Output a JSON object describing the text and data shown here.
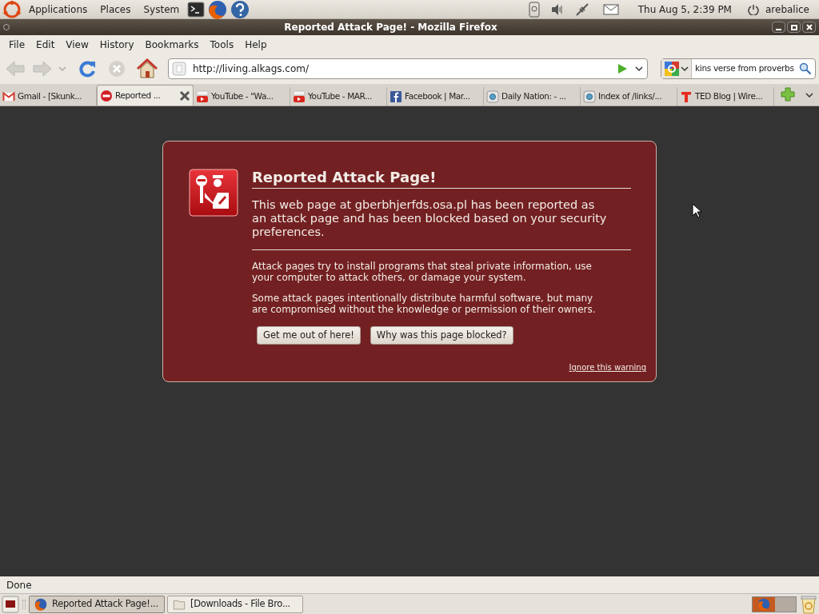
{
  "top_panel": {
    "menus": [
      "Applications",
      "Places",
      "System"
    ],
    "clock": "Thu Aug  5,  2:39 PM",
    "user": "arebalice"
  },
  "window": {
    "title": "Reported Attack Page! - Mozilla Firefox"
  },
  "menu_bar": [
    "File",
    "Edit",
    "View",
    "History",
    "Bookmarks",
    "Tools",
    "Help"
  ],
  "nav": {
    "url": "http://living.alkags.com/",
    "search_value": "kins verse from proverbs"
  },
  "tabs": [
    {
      "kind": "gmail",
      "label": "Gmail - [Skunk...",
      "selected": false
    },
    {
      "kind": "blocked",
      "label": "Reported ...",
      "selected": true
    },
    {
      "kind": "youtube",
      "label": "YouTube - \"Wa...",
      "selected": false
    },
    {
      "kind": "youtube",
      "label": "YouTube - MAR...",
      "selected": false
    },
    {
      "kind": "facebook",
      "label": "Facebook | Mar...",
      "selected": false
    },
    {
      "kind": "globe",
      "label": "Daily Nation: - ...",
      "selected": false
    },
    {
      "kind": "globe",
      "label": "Index of /links/...",
      "selected": false
    },
    {
      "kind": "ted",
      "label": "TED Blog | Wire...",
      "selected": false
    }
  ],
  "warning": {
    "title": "Reported Attack Page!",
    "lead": "This web page at gberbhjerfds.osa.pl has been reported as an attack page and has been blocked based on your security preferences.",
    "paragraphs": [
      "Attack pages try to install programs that steal private information, use your computer to attack others, or damage your system.",
      "Some attack pages intentionally distribute harmful software, but many are compromised without the knowledge or permission of their owners."
    ],
    "buttons": [
      "Get me out of here!",
      "Why was this page blocked?"
    ],
    "ignore_link": "Ignore this warning"
  },
  "status_bar": "Done",
  "taskbar": [
    {
      "label": "Reported Attack Page!...",
      "kind": "firefox",
      "selected": true
    },
    {
      "label": "[Downloads - File Bro...",
      "kind": "folder",
      "selected": false
    }
  ]
}
